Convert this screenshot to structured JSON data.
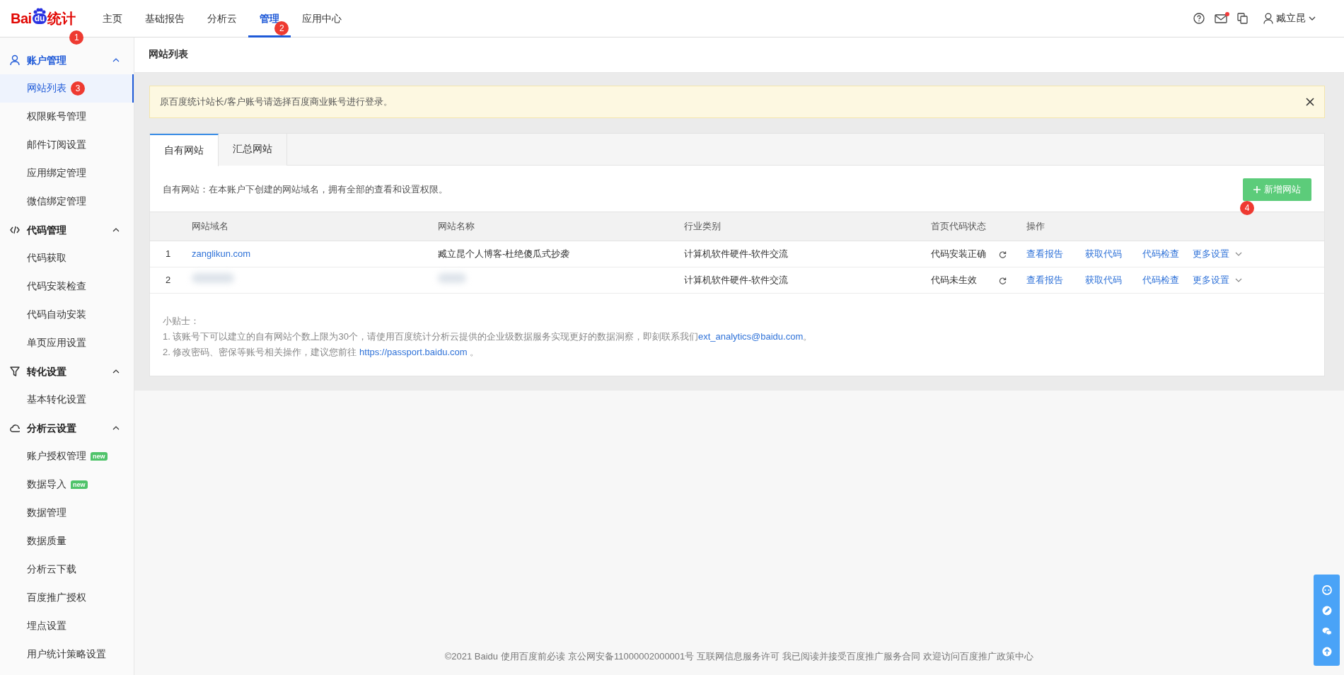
{
  "logo": {
    "parts": [
      "Bai",
      "du",
      "统计"
    ],
    "marker": "1"
  },
  "nav": [
    {
      "label": "主页",
      "selected": false
    },
    {
      "label": "基础报告",
      "selected": false
    },
    {
      "label": "分析云",
      "selected": false
    },
    {
      "label": "管理",
      "selected": true,
      "marker": "2"
    },
    {
      "label": "应用中心",
      "selected": false
    }
  ],
  "header_right": {
    "mail_unread": true,
    "user_name": "臧立昆"
  },
  "sidebar": {
    "groups": [
      {
        "label": "账户管理",
        "kind": "user",
        "active": true,
        "expanded": true,
        "items": [
          {
            "label": "网站列表",
            "selected": true,
            "marker": "3"
          },
          {
            "label": "权限账号管理",
            "selected": false
          },
          {
            "label": "邮件订阅设置",
            "selected": false
          },
          {
            "label": "应用绑定管理",
            "selected": false
          },
          {
            "label": "微信绑定管理",
            "selected": false
          }
        ]
      },
      {
        "label": "代码管理",
        "kind": "code",
        "active": false,
        "expanded": true,
        "items": [
          {
            "label": "代码获取",
            "selected": false
          },
          {
            "label": "代码安装检查",
            "selected": false
          },
          {
            "label": "代码自动安装",
            "selected": false
          },
          {
            "label": "单页应用设置",
            "selected": false
          }
        ]
      },
      {
        "label": "转化设置",
        "kind": "filter",
        "active": false,
        "expanded": true,
        "items": [
          {
            "label": "基本转化设置",
            "selected": false
          }
        ]
      },
      {
        "label": "分析云设置",
        "kind": "cloud",
        "active": false,
        "expanded": true,
        "items": [
          {
            "label": "账户授权管理",
            "selected": false,
            "badge": "new"
          },
          {
            "label": "数据导入",
            "selected": false,
            "badge": "new"
          },
          {
            "label": "数据管理",
            "selected": false
          },
          {
            "label": "数据质量",
            "selected": false
          },
          {
            "label": "分析云下载",
            "selected": false
          },
          {
            "label": "百度推广授权",
            "selected": false
          },
          {
            "label": "埋点设置",
            "selected": false
          },
          {
            "label": "用户统计策略设置",
            "selected": false
          }
        ]
      }
    ]
  },
  "page_title": "网站列表",
  "alert": {
    "text": "原百度统计站长/客户账号请选择百度商业账号进行登录。",
    "closable": true
  },
  "tabs": [
    {
      "label": "自有网站",
      "selected": true
    },
    {
      "label": "汇总网站",
      "selected": false
    }
  ],
  "description": "自有网站：在本账户下创建的网站域名，拥有全部的查看和设置权限。",
  "add_button": {
    "label": "新增网站",
    "marker": "4"
  },
  "table": {
    "columns": [
      "网站域名",
      "网站名称",
      "行业类别",
      "首页代码状态",
      "操作"
    ],
    "rows": [
      {
        "index": "1",
        "redacted": false,
        "domain": "zanglikun.com",
        "name": "臧立昆个人博客-杜绝傻瓜式抄袭",
        "category": "计算机软件硬件-软件交流",
        "status": "代码安装正确",
        "actions": [
          "查看报告",
          "获取代码",
          "代码检查",
          "更多设置"
        ]
      },
      {
        "index": "2",
        "redacted": true,
        "category": "计算机软件硬件-软件交流",
        "status": "代码未生效",
        "actions": [
          "查看报告",
          "获取代码",
          "代码检查",
          "更多设置"
        ]
      }
    ]
  },
  "tips": {
    "title": "小贴士：",
    "lines": [
      {
        "text": "1. 该账号下可以建立的自有网站个数上限为30个，请使用百度统计分析云提供的企业级数据服务实现更好的数据洞察，即刻联系我们",
        "link": "ext_analytics@baidu.com",
        "suffix": "。"
      },
      {
        "text": "2. 修改密码、密保等账号相关操作，建议您前往 ",
        "link": "https://passport.baidu.com",
        "suffix": " 。"
      }
    ]
  },
  "footer": [
    "©2021 Baidu",
    "使用百度前必读",
    "京公网安备11000002000001号",
    "互联网信息服务许可",
    "我已阅读并接受百度推广服务合同",
    "欢迎访问百度推广政策中心"
  ]
}
